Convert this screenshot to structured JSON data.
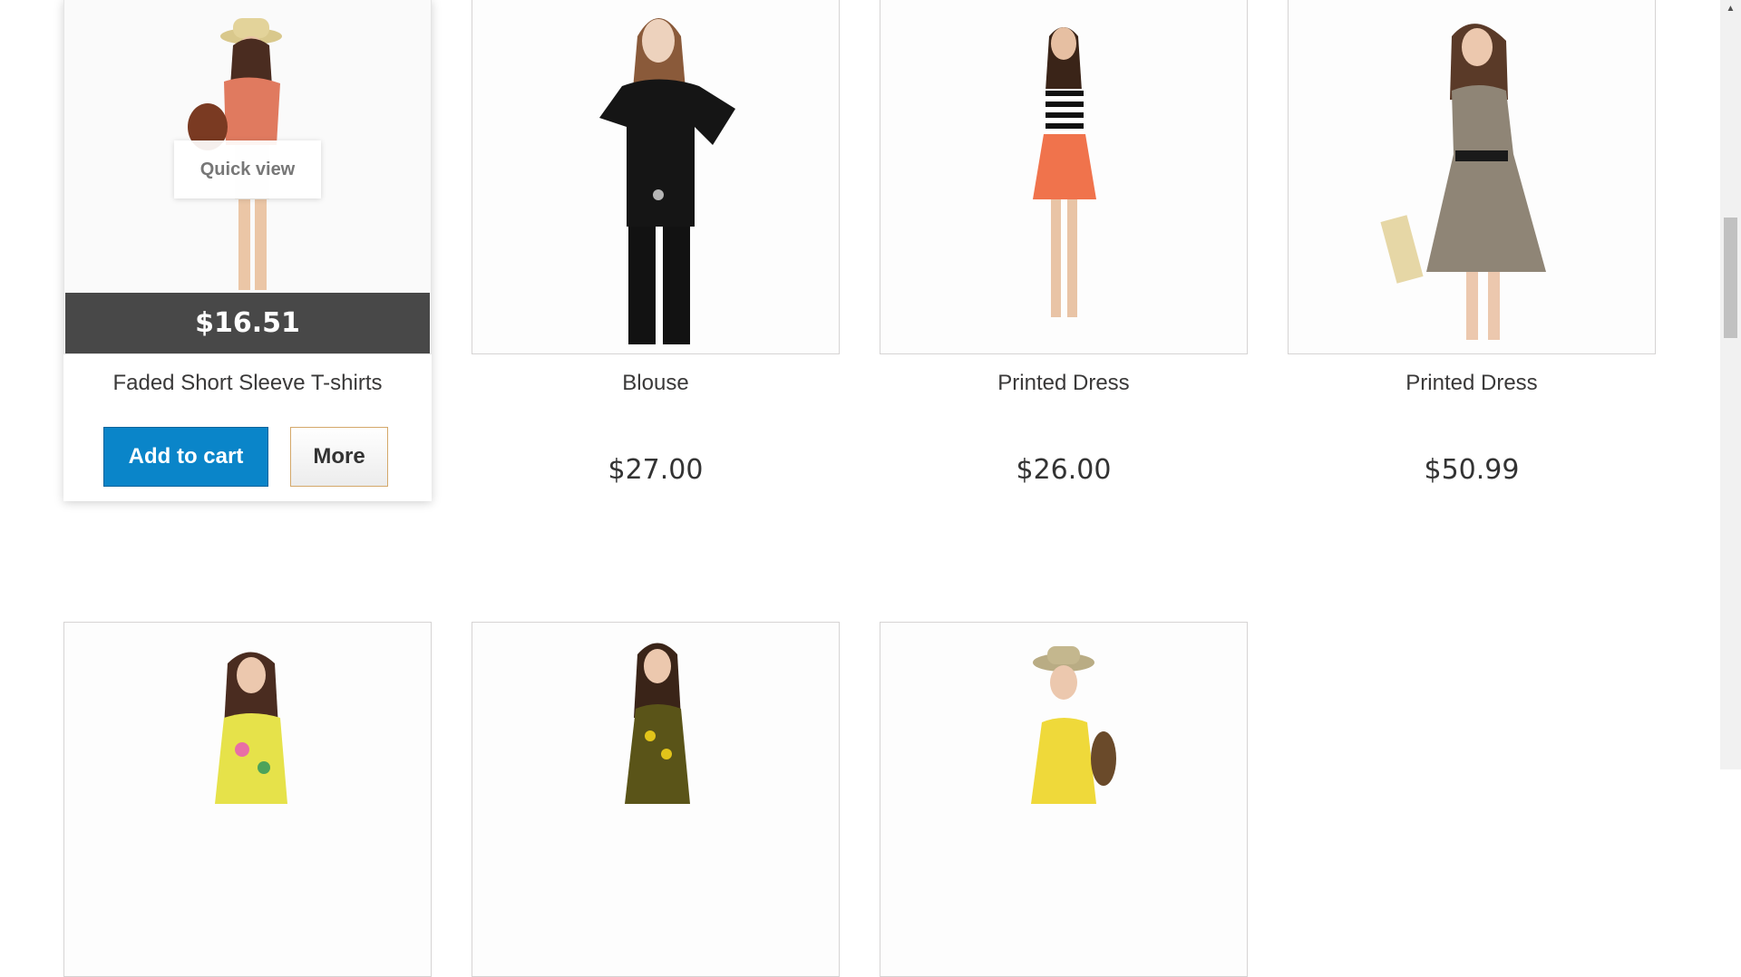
{
  "products": [
    {
      "name": "Faded Short Sleeve T-shirts",
      "price": "$16.51",
      "image_alt": "woman in straw hat and coral top"
    },
    {
      "name": "Blouse",
      "price": "$27.00",
      "image_alt": "woman in black blouse"
    },
    {
      "name": "Printed Dress",
      "price": "$26.00",
      "image_alt": "woman in striped top and orange skirt"
    },
    {
      "name": "Printed Dress",
      "price": "$50.99",
      "image_alt": "woman in printed chiffon dress"
    }
  ],
  "hover_card": {
    "quick_view_label": "Quick view",
    "add_to_cart_label": "Add to cart",
    "more_label": "More"
  },
  "colors": {
    "accent_blue": "#0a85c9",
    "price_overlay": "#484848",
    "more_border": "#d4a86a"
  },
  "scrollbar": {
    "up_arrow_icon": "triangle-up-icon"
  }
}
